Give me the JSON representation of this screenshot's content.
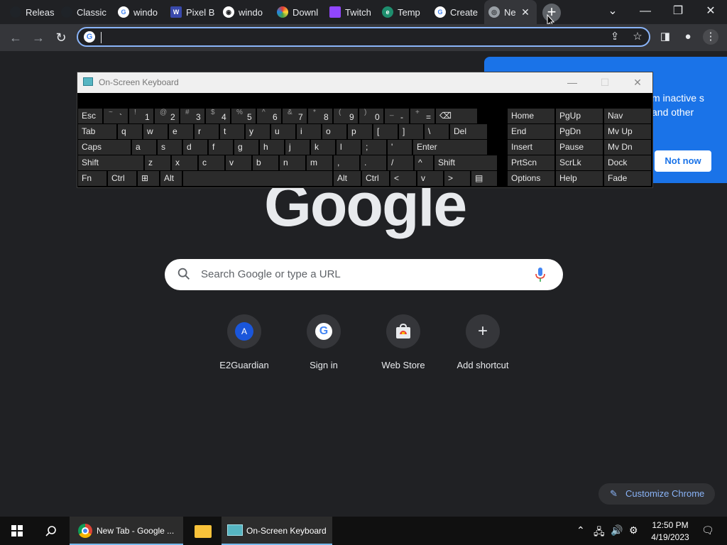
{
  "tabs": [
    {
      "label": "Releas",
      "icon": "github-icon"
    },
    {
      "label": "Classic",
      "icon": "github-icon"
    },
    {
      "label": "windo",
      "icon": "google-icon"
    },
    {
      "label": "Pixel B",
      "icon": "site-icon"
    },
    {
      "label": "windo",
      "icon": "globe-icon"
    },
    {
      "label": "Downl",
      "icon": "site-icon"
    },
    {
      "label": "Twitch",
      "icon": "twitch-icon"
    },
    {
      "label": "Temp",
      "icon": "site-icon"
    },
    {
      "label": "Create",
      "icon": "google-icon"
    },
    {
      "label": "Ne",
      "icon": "chrome-icon",
      "active": true
    }
  ],
  "promo": {
    "text": "m inactive s and other",
    "button": "Not now"
  },
  "logo": "Google",
  "search": {
    "placeholder": "Search Google or type a URL"
  },
  "shortcuts": [
    {
      "label": "E2Guardian",
      "badge": "A"
    },
    {
      "label": "Sign in"
    },
    {
      "label": "Web Store"
    },
    {
      "label": "Add shortcut"
    }
  ],
  "customize_label": "Customize Chrome",
  "osk": {
    "title": "On-Screen Keyboard",
    "row1": [
      [
        "Esc",
        ""
      ],
      [
        "`",
        "~"
      ],
      [
        "1",
        "!"
      ],
      [
        "2",
        "@"
      ],
      [
        "3",
        "#"
      ],
      [
        "4",
        "$"
      ],
      [
        "5",
        "%"
      ],
      [
        "6",
        "^"
      ],
      [
        "7",
        "&"
      ],
      [
        "8",
        "*"
      ],
      [
        "9",
        "("
      ],
      [
        "0",
        ")"
      ],
      [
        "-",
        "_"
      ],
      [
        "=",
        "+"
      ],
      [
        "⌫",
        ""
      ]
    ],
    "row2": [
      "Tab",
      "q",
      "w",
      "e",
      "r",
      "t",
      "y",
      "u",
      "i",
      "o",
      "p",
      "[",
      "]",
      "\\",
      "Del"
    ],
    "row3": [
      "Caps",
      "a",
      "s",
      "d",
      "f",
      "g",
      "h",
      "j",
      "k",
      "l",
      ";",
      "'",
      "Enter"
    ],
    "row4": [
      "Shift",
      "z",
      "x",
      "c",
      "v",
      "b",
      "n",
      "m",
      ",",
      ".",
      "/",
      "^",
      "Shift"
    ],
    "row5": [
      "Fn",
      "Ctrl",
      "⊞",
      "Alt",
      "",
      "Alt",
      "Ctrl",
      "<",
      "v",
      ">",
      "▤"
    ],
    "nav_col1": [
      "Home",
      "End",
      "Insert",
      "PrtScn",
      "Options"
    ],
    "nav_col2": [
      "PgUp",
      "PgDn",
      "Pause",
      "ScrLk",
      "Help"
    ],
    "nav_col3": [
      "Nav",
      "Mv Up",
      "Mv Dn",
      "Dock",
      "Fade"
    ]
  },
  "taskbar": {
    "chrome_label": "New Tab - Google ...",
    "osk_label": "On-Screen Keyboard",
    "time": "12:50 PM",
    "date": "4/19/2023"
  }
}
